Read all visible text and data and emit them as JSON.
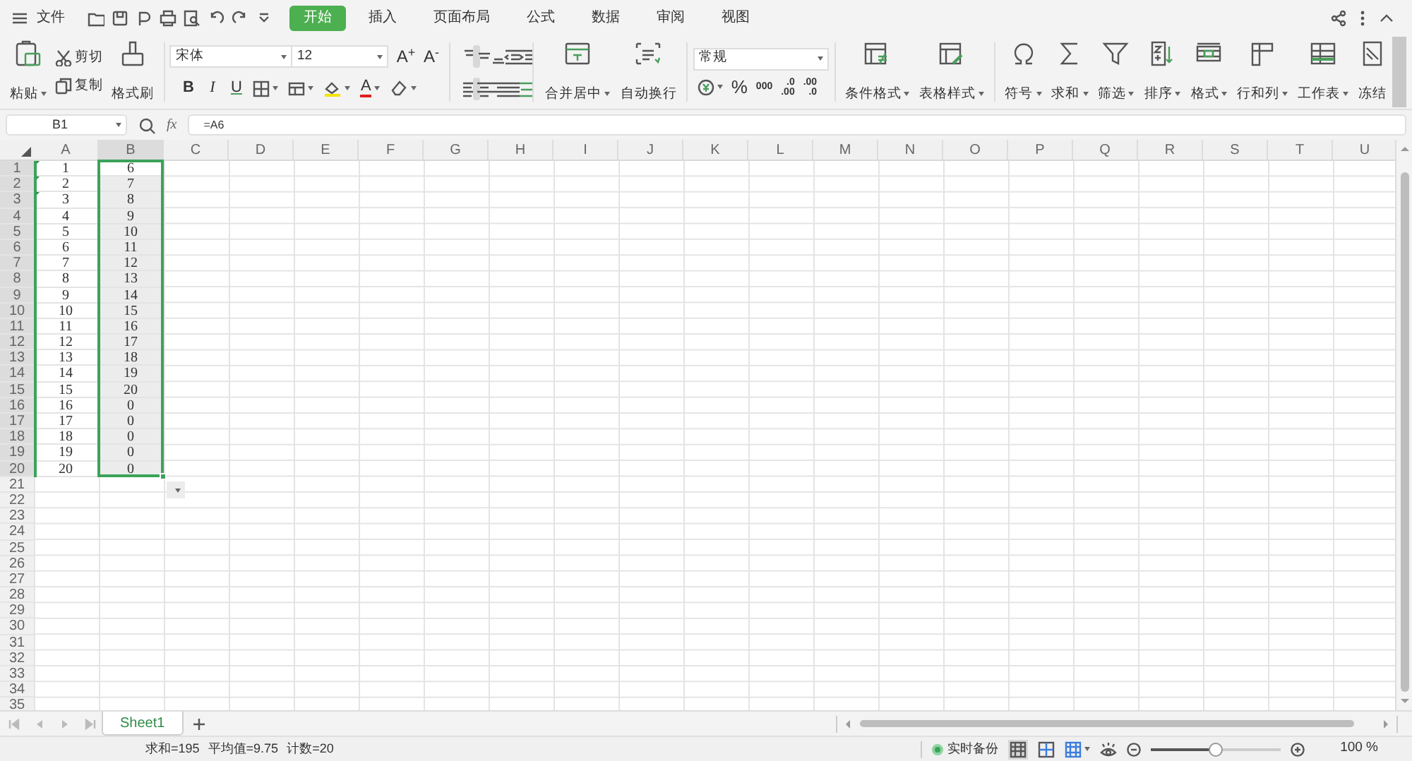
{
  "menu": {
    "file": "文件",
    "tabs": [
      {
        "label": "开始",
        "selected": true
      },
      {
        "label": "插入",
        "selected": false
      },
      {
        "label": "页面布局",
        "selected": false
      },
      {
        "label": "公式",
        "selected": false
      },
      {
        "label": "数据",
        "selected": false
      },
      {
        "label": "审阅",
        "selected": false
      },
      {
        "label": "视图",
        "selected": false
      }
    ]
  },
  "ribbon": {
    "paste": {
      "label": "粘贴",
      "dropdown": true
    },
    "cut": "剪切",
    "copy": "复制",
    "format_painter": {
      "label": "格式刷",
      "dropdown": false
    },
    "font_name": "宋体",
    "font_size": "12",
    "grow_font": "A$^{+}$",
    "shrink_font": "A$^{-}$",
    "bold": "B",
    "italic": "I",
    "underline": "U",
    "font_color": "A",
    "number_format": "常规",
    "percent": "%",
    "thousands": "000",
    "add_decimal": [
      ".0",
      ".00"
    ],
    "remove_decimal": [
      ".00",
      ".0"
    ],
    "large_buttons": [
      {
        "label": "合并居中",
        "dropdown": true
      },
      {
        "label": "自动换行",
        "dropdown": false
      },
      {
        "label": "条件格式",
        "dropdown": true
      },
      {
        "label": "表格样式",
        "dropdown": true
      },
      {
        "label": "符号",
        "dropdown": true
      },
      {
        "label": "求和",
        "dropdown": true
      },
      {
        "label": "筛选",
        "dropdown": true
      },
      {
        "label": "排序",
        "dropdown": true
      },
      {
        "label": "格式",
        "dropdown": true
      },
      {
        "label": "行和列",
        "dropdown": true
      },
      {
        "label": "工作表",
        "dropdown": true
      },
      {
        "label": "冻结",
        "dropdown": false
      }
    ]
  },
  "formula_bar": {
    "name_box": "B1",
    "fx_label": "fx",
    "formula": "=A6"
  },
  "columns": [
    {
      "label": "A",
      "selected": false
    },
    {
      "label": "B",
      "selected": true
    },
    {
      "label": "C",
      "selected": false
    },
    {
      "label": "D",
      "selected": false
    },
    {
      "label": "E",
      "selected": false
    },
    {
      "label": "F",
      "selected": false
    },
    {
      "label": "G",
      "selected": false
    },
    {
      "label": "H",
      "selected": false
    },
    {
      "label": "I",
      "selected": false
    },
    {
      "label": "J",
      "selected": false
    },
    {
      "label": "K",
      "selected": false
    },
    {
      "label": "L",
      "selected": false
    },
    {
      "label": "M",
      "selected": false
    },
    {
      "label": "N",
      "selected": false
    },
    {
      "label": "O",
      "selected": false
    },
    {
      "label": "P",
      "selected": false
    },
    {
      "label": "Q",
      "selected": false
    },
    {
      "label": "R",
      "selected": false
    },
    {
      "label": "S",
      "selected": false
    },
    {
      "label": "T",
      "selected": false
    },
    {
      "label": "U",
      "selected": false
    }
  ],
  "rows": [
    {
      "number": "1",
      "selected": true,
      "cells": [
        {
          "value": "1",
          "marker": true,
          "selected": false,
          "active": false
        },
        {
          "value": "6",
          "marker": false,
          "selected": true,
          "active": true
        }
      ]
    },
    {
      "number": "2",
      "selected": true,
      "cells": [
        {
          "value": "2",
          "marker": true,
          "selected": false,
          "active": false
        },
        {
          "value": "7",
          "marker": false,
          "selected": true,
          "active": false
        }
      ]
    },
    {
      "number": "3",
      "selected": true,
      "cells": [
        {
          "value": "3",
          "marker": true,
          "selected": false,
          "active": false
        },
        {
          "value": "8",
          "marker": false,
          "selected": true,
          "active": false
        }
      ]
    },
    {
      "number": "4",
      "selected": true,
      "cells": [
        {
          "value": "4",
          "marker": false,
          "selected": false,
          "active": false
        },
        {
          "value": "9",
          "marker": false,
          "selected": true,
          "active": false
        }
      ]
    },
    {
      "number": "5",
      "selected": true,
      "cells": [
        {
          "value": "5",
          "marker": false,
          "selected": false,
          "active": false
        },
        {
          "value": "10",
          "marker": false,
          "selected": true,
          "active": false
        }
      ]
    },
    {
      "number": "6",
      "selected": true,
      "cells": [
        {
          "value": "6",
          "marker": false,
          "selected": false,
          "active": false
        },
        {
          "value": "11",
          "marker": false,
          "selected": true,
          "active": false
        }
      ]
    },
    {
      "number": "7",
      "selected": true,
      "cells": [
        {
          "value": "7",
          "marker": false,
          "selected": false,
          "active": false
        },
        {
          "value": "12",
          "marker": false,
          "selected": true,
          "active": false
        }
      ]
    },
    {
      "number": "8",
      "selected": true,
      "cells": [
        {
          "value": "8",
          "marker": false,
          "selected": false,
          "active": false
        },
        {
          "value": "13",
          "marker": false,
          "selected": true,
          "active": false
        }
      ]
    },
    {
      "number": "9",
      "selected": true,
      "cells": [
        {
          "value": "9",
          "marker": false,
          "selected": false,
          "active": false
        },
        {
          "value": "14",
          "marker": false,
          "selected": true,
          "active": false
        }
      ]
    },
    {
      "number": "10",
      "selected": true,
      "cells": [
        {
          "value": "10",
          "marker": false,
          "selected": false,
          "active": false
        },
        {
          "value": "15",
          "marker": false,
          "selected": true,
          "active": false
        }
      ]
    },
    {
      "number": "11",
      "selected": true,
      "cells": [
        {
          "value": "11",
          "marker": false,
          "selected": false,
          "active": false
        },
        {
          "value": "16",
          "marker": false,
          "selected": true,
          "active": false
        }
      ]
    },
    {
      "number": "12",
      "selected": true,
      "cells": [
        {
          "value": "12",
          "marker": false,
          "selected": false,
          "active": false
        },
        {
          "value": "17",
          "marker": false,
          "selected": true,
          "active": false
        }
      ]
    },
    {
      "number": "13",
      "selected": true,
      "cells": [
        {
          "value": "13",
          "marker": false,
          "selected": false,
          "active": false
        },
        {
          "value": "18",
          "marker": false,
          "selected": true,
          "active": false
        }
      ]
    },
    {
      "number": "14",
      "selected": true,
      "cells": [
        {
          "value": "14",
          "marker": false,
          "selected": false,
          "active": false
        },
        {
          "value": "19",
          "marker": false,
          "selected": true,
          "active": false
        }
      ]
    },
    {
      "number": "15",
      "selected": true,
      "cells": [
        {
          "value": "15",
          "marker": false,
          "selected": false,
          "active": false
        },
        {
          "value": "20",
          "marker": false,
          "selected": true,
          "active": false
        }
      ]
    },
    {
      "number": "16",
      "selected": true,
      "cells": [
        {
          "value": "16",
          "marker": false,
          "selected": false,
          "active": false
        },
        {
          "value": "0",
          "marker": false,
          "selected": true,
          "active": false
        }
      ]
    },
    {
      "number": "17",
      "selected": true,
      "cells": [
        {
          "value": "17",
          "marker": false,
          "selected": false,
          "active": false
        },
        {
          "value": "0",
          "marker": false,
          "selected": true,
          "active": false
        }
      ]
    },
    {
      "number": "18",
      "selected": true,
      "cells": [
        {
          "value": "18",
          "marker": false,
          "selected": false,
          "active": false
        },
        {
          "value": "0",
          "marker": false,
          "selected": true,
          "active": false
        }
      ]
    },
    {
      "number": "19",
      "selected": true,
      "cells": [
        {
          "value": "19",
          "marker": false,
          "selected": false,
          "active": false
        },
        {
          "value": "0",
          "marker": false,
          "selected": true,
          "active": false
        }
      ]
    },
    {
      "number": "20",
      "selected": true,
      "cells": [
        {
          "value": "20",
          "marker": false,
          "selected": false,
          "active": false
        },
        {
          "value": "0",
          "marker": false,
          "selected": true,
          "active": false
        }
      ]
    },
    {
      "number": "21",
      "selected": false
    },
    {
      "number": "22",
      "selected": false
    },
    {
      "number": "23",
      "selected": false
    },
    {
      "number": "24",
      "selected": false
    },
    {
      "number": "25",
      "selected": false
    },
    {
      "number": "26",
      "selected": false
    },
    {
      "number": "27",
      "selected": false
    },
    {
      "number": "28",
      "selected": false
    },
    {
      "number": "29",
      "selected": false
    },
    {
      "number": "30",
      "selected": false
    },
    {
      "number": "31",
      "selected": false
    },
    {
      "number": "32",
      "selected": false
    },
    {
      "number": "33",
      "selected": false
    },
    {
      "number": "34",
      "selected": false
    },
    {
      "number": "35",
      "selected": false
    }
  ],
  "sheet_tabs": [
    {
      "label": "Sheet1",
      "selected": true
    }
  ],
  "status_bar": {
    "summary": [
      "求和=195",
      "平均值=9.75",
      "计数=20"
    ],
    "backup": "实时备份",
    "zoom": {
      "level": 0.5,
      "reading": "100 %"
    }
  }
}
